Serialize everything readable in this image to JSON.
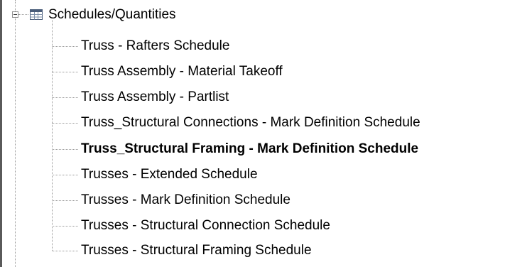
{
  "tree": {
    "parent": {
      "label": "Schedules/Quantities",
      "icon": "table-icon",
      "expanded": true
    },
    "children": [
      {
        "label": "Truss - Rafters  Schedule",
        "bold": false
      },
      {
        "label": "Truss Assembly - Material Takeoff",
        "bold": false
      },
      {
        "label": "Truss Assembly - Partlist",
        "bold": false
      },
      {
        "label": "Truss_Structural Connections - Mark Definition Schedule",
        "bold": false
      },
      {
        "label": "Truss_Structural Framing - Mark Definition  Schedule",
        "bold": true
      },
      {
        "label": "Trusses - Extended Schedule",
        "bold": false
      },
      {
        "label": "Trusses - Mark Definition Schedule",
        "bold": false
      },
      {
        "label": "Trusses - Structural Connection Schedule",
        "bold": false
      },
      {
        "label": "Trusses - Structural Framing Schedule",
        "bold": false
      }
    ]
  },
  "colors": {
    "tree_line": "#9a9a9a",
    "left_border": "#5a5a5a",
    "table_icon_header": "#4a5d7a",
    "table_icon_cells": "#7d8fa8"
  }
}
